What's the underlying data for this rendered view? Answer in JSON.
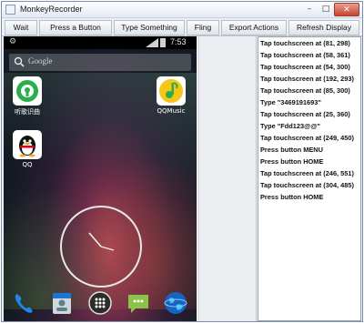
{
  "window": {
    "title": "MonkeyRecorder",
    "controls": {
      "minimize": "–",
      "maximize": "□",
      "close": "✕"
    }
  },
  "toolbar": {
    "buttons": [
      "Wait",
      "Press a Button",
      "Type Something",
      "Fling",
      "Export Actions",
      "Refresh Display"
    ]
  },
  "phone": {
    "status": {
      "time": "7:53",
      "left_icon": "usb-debug-icon"
    },
    "search": {
      "placeholder": "Google"
    },
    "apps": [
      {
        "label": "听歌识曲",
        "icon": "song-recognition-icon"
      },
      {
        "label": "QQMusic",
        "icon": "qqmusic-icon"
      },
      {
        "label": "QQ",
        "icon": "qq-penguin-icon"
      }
    ],
    "dock": [
      "phone-icon",
      "contacts-icon",
      "app-drawer-icon",
      "messaging-icon",
      "browser-icon"
    ]
  },
  "log": {
    "lines": [
      "Tap touchscreen at (81, 298)",
      "Tap touchscreen at (58, 361)",
      "Tap touchscreen at (54, 300)",
      "Tap touchscreen at (192, 293)",
      "Tap touchscreen at (85, 300)",
      "Type \"3469191693\"",
      "Tap touchscreen at (25, 360)",
      "Type \"Fdd123@@\"",
      "Tap touchscreen at (249, 450)",
      "Press button MENU",
      "Press button HOME",
      "Tap touchscreen at (246, 551)",
      "Tap touchscreen at (304, 485)",
      "Press button HOME"
    ]
  },
  "colors": {
    "close_button": "#c8432e",
    "qqmusic_yellow": "#f5c518",
    "wechat_green": "#2aae4a"
  }
}
